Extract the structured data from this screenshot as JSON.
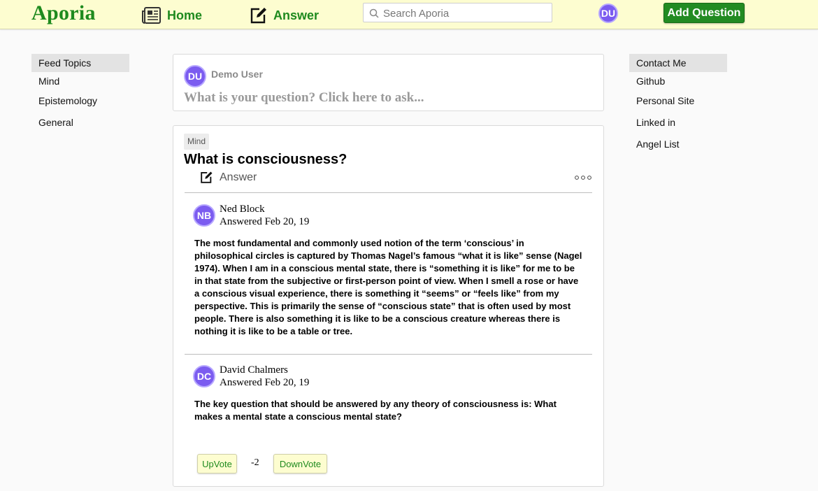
{
  "header": {
    "logo": "Aporia",
    "nav": {
      "home_label": "Home",
      "answer_label": "Answer"
    },
    "search": {
      "placeholder": "Search Aporia",
      "value": ""
    },
    "user_initials": "DU",
    "add_question_label": "Add Question",
    "brand_color": "#1e8a1e",
    "header_bg": "#fdfdd0"
  },
  "left_sidebar": {
    "title": "Feed Topics",
    "items": [
      "Mind",
      "Epistemology",
      "General"
    ]
  },
  "right_sidebar": {
    "title": "Contact Me",
    "items": [
      "Github",
      "Personal Site",
      "Linked in",
      "Angel List"
    ]
  },
  "ask_box": {
    "user_initials": "DU",
    "user_name": "Demo User",
    "prompt": "What is your question? Click here to ask..."
  },
  "question": {
    "topic": "Mind",
    "title": "What is consciousness?",
    "answer_label": "Answer",
    "answers": [
      {
        "initials": "NB",
        "name": "Ned Block",
        "date": "Answered Feb 20, 19",
        "text": "The most fundamental and commonly used notion of the term ‘conscious’ in philosophical circles is captured by Thomas Nagel’s famous “what it is like” sense (Nagel 1974). When I am in a conscious mental state, there is “something it is like” for me to be in that state from the subjective or first-person point of view. When I smell a rose or have a conscious visual experience, there is something it “seems” or “feels like” from my perspective. This is primarily the sense of “conscious state” that is often used by most people. There is also something it is like to be a conscious creature whereas there is nothing it is like to be a table or tree."
      },
      {
        "initials": "DC",
        "name": "David Chalmers",
        "date": "Answered Feb 20, 19",
        "text": "The key question that should be answered by any theory of consciousness is: What makes a mental state a conscious mental state?"
      }
    ],
    "votes": {
      "upvote_label": "UpVote",
      "count": "-2",
      "downvote_label": "DownVote"
    }
  },
  "icons": {
    "home": "newspaper-icon",
    "answer": "edit-icon",
    "search": "search-icon",
    "more": "more-options-icon"
  },
  "colors": {
    "avatar": "#7b5cf0",
    "add_button": "#228b22"
  }
}
